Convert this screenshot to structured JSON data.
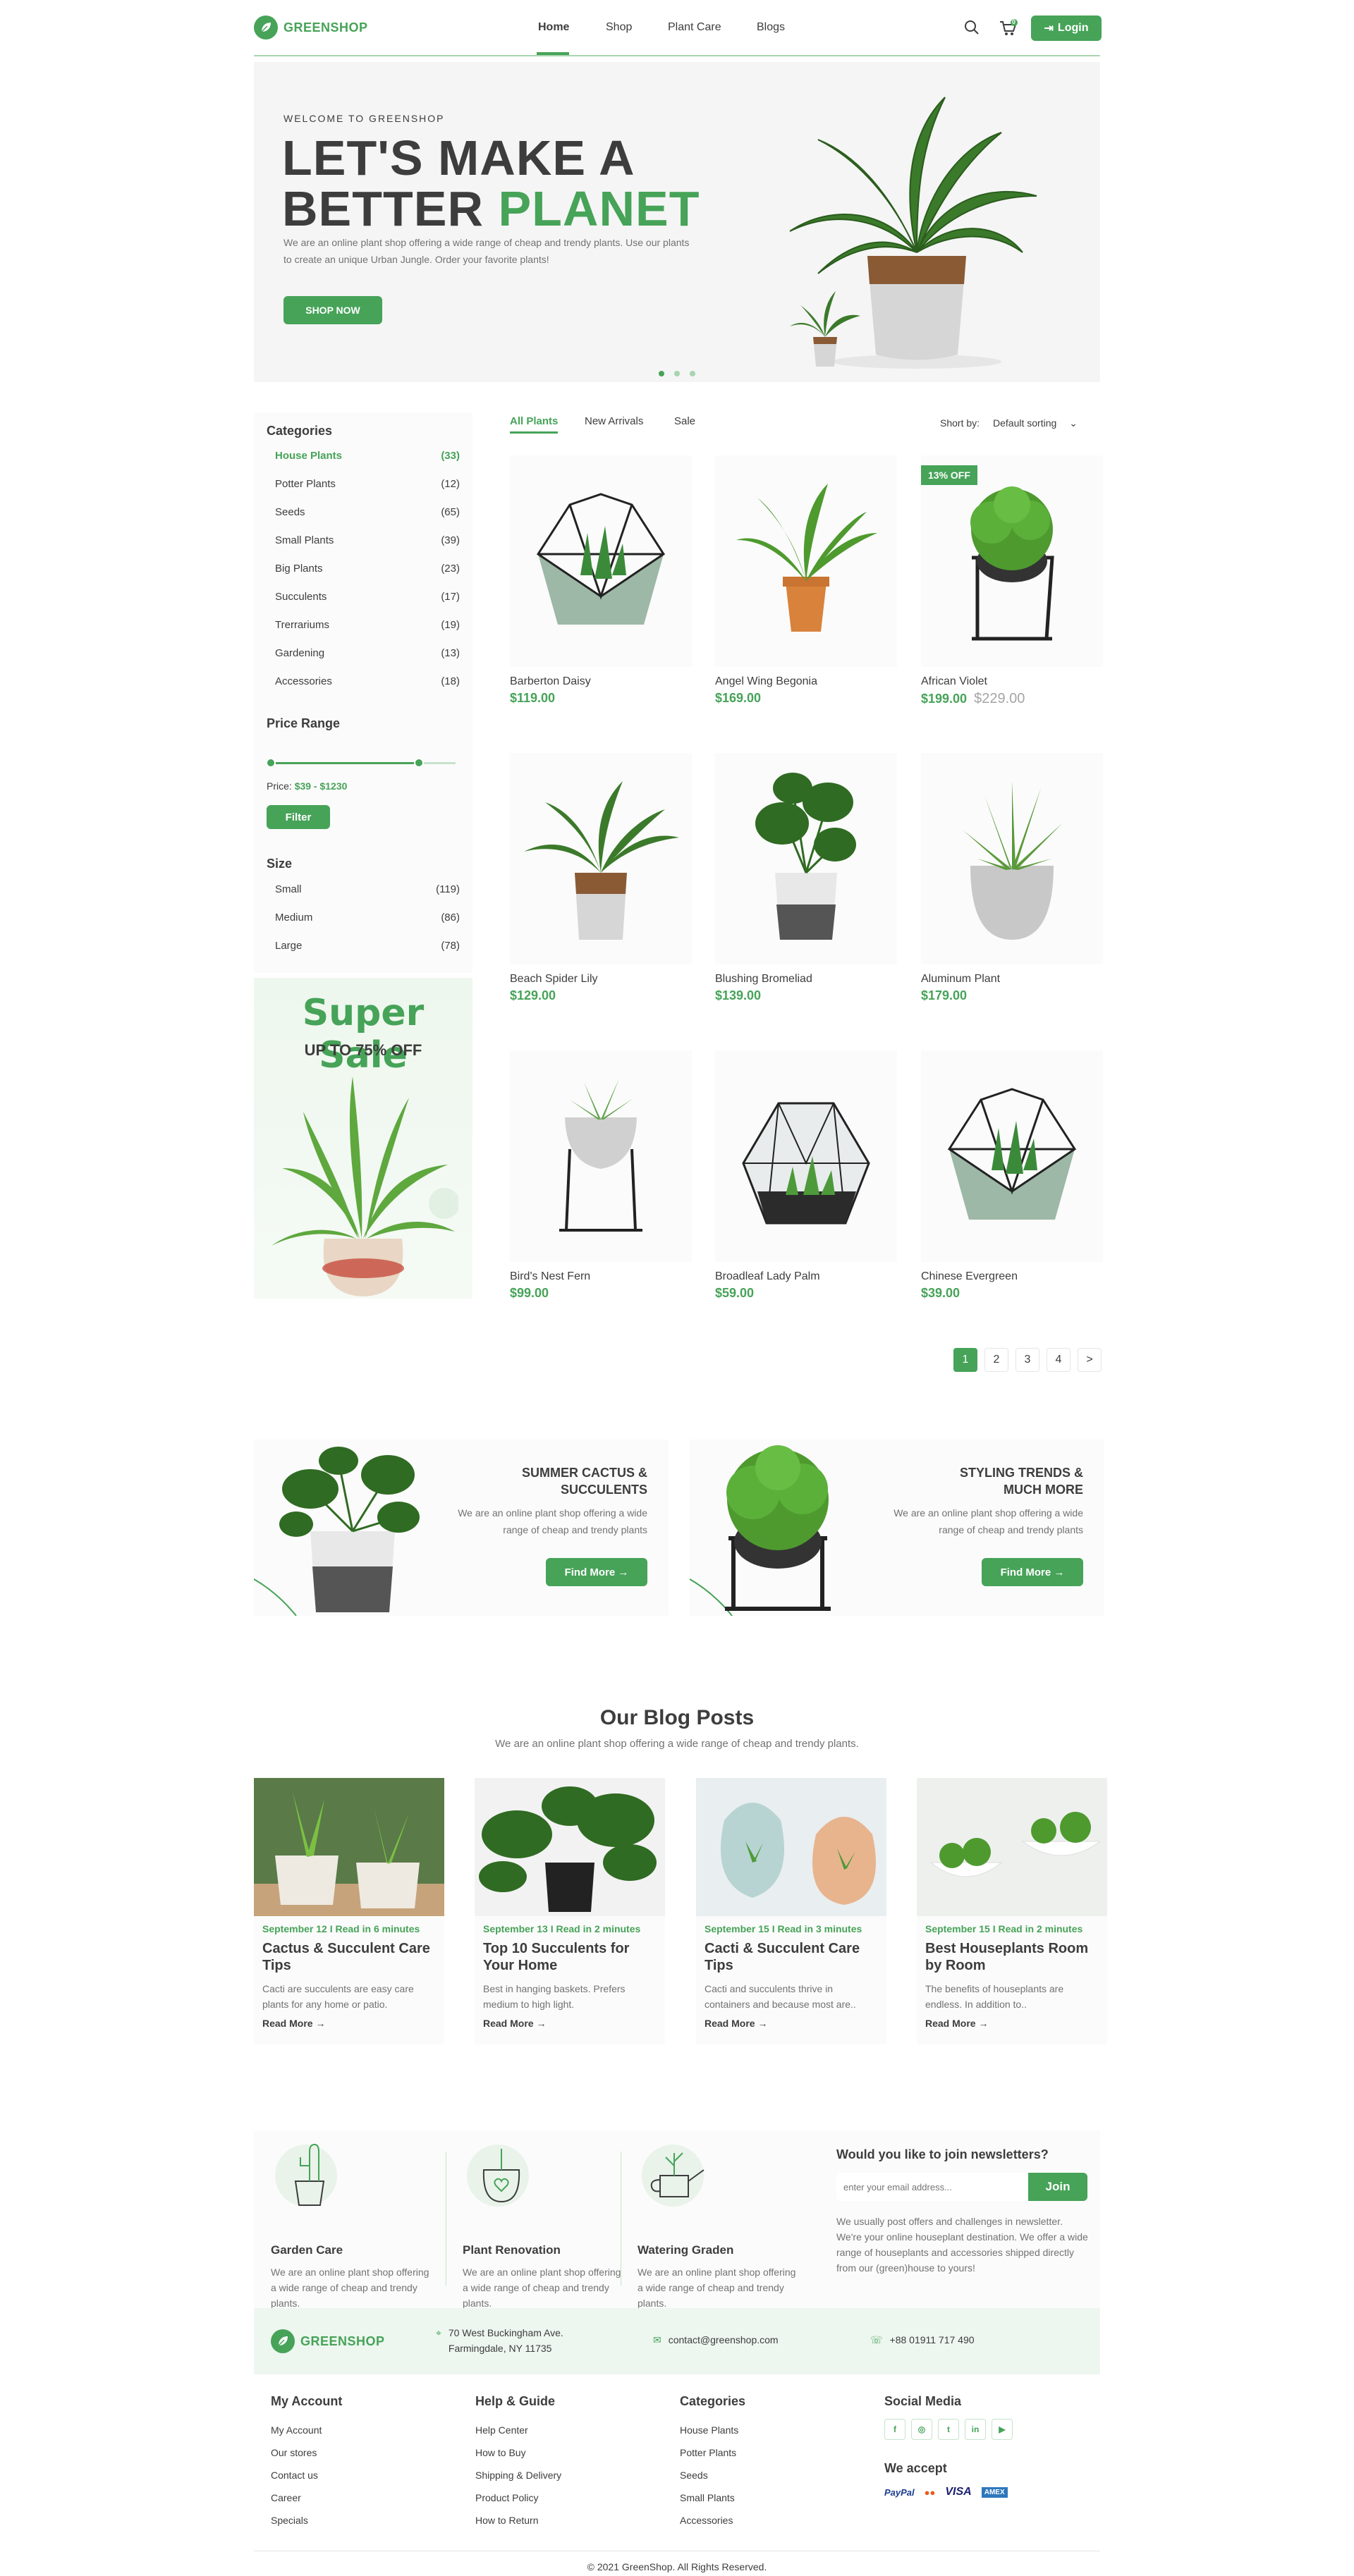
{
  "colors": {
    "accent": "#46a358",
    "text": "#3d3d3d",
    "muted": "#727272"
  },
  "header": {
    "brand": "GREENSHOP",
    "nav": [
      {
        "label": "Home",
        "active": true
      },
      {
        "label": "Shop"
      },
      {
        "label": "Plant Care"
      },
      {
        "label": "Blogs"
      }
    ],
    "cart_count": "0",
    "login_label": "Login",
    "icons": [
      "search-icon",
      "cart-icon",
      "login-icon"
    ]
  },
  "hero": {
    "welcome": "WELCOME TO GREENSHOP",
    "title_line1": "LET'S MAKE A",
    "title_line2_a": "BETTER ",
    "title_line2_b": "PLANET",
    "description": "We are an online plant shop offering a wide range of cheap and trendy plants. Use our plants to create an unique Urban Jungle. Order your favorite plants!",
    "cta": "SHOP NOW",
    "active_slide": 1,
    "slides": 3
  },
  "sidebar": {
    "categories_title": "Categories",
    "categories": [
      {
        "label": "House Plants",
        "count": "(33)",
        "active": true
      },
      {
        "label": "Potter Plants",
        "count": "(12)"
      },
      {
        "label": "Seeds",
        "count": "(65)"
      },
      {
        "label": "Small Plants",
        "count": "(39)"
      },
      {
        "label": "Big Plants",
        "count": "(23)"
      },
      {
        "label": "Succulents",
        "count": "(17)"
      },
      {
        "label": "Trerrariums",
        "count": "(19)"
      },
      {
        "label": "Gardening",
        "count": "(13)"
      },
      {
        "label": "Accessories",
        "count": "(18)"
      }
    ],
    "price_title": "Price Range",
    "price_label": "Price: ",
    "price_value": "$39 - $1230",
    "price_min_fraction": 0.0,
    "price_max_fraction": 0.8,
    "filter_label": "Filter",
    "size_title": "Size",
    "sizes": [
      {
        "label": "Small",
        "count": "(119)"
      },
      {
        "label": "Medium",
        "count": "(86)"
      },
      {
        "label": "Large",
        "count": "(78)"
      }
    ],
    "sale": {
      "title": "Super Sale",
      "subtitle": "UP TO 75% OFF"
    }
  },
  "products": {
    "tabs": [
      {
        "label": "All Plants",
        "active": true
      },
      {
        "label": "New Arrivals"
      },
      {
        "label": "Sale"
      }
    ],
    "sort_label": "Short by:",
    "sort_value": "Default sorting",
    "items": [
      {
        "name": "Barberton Daisy",
        "price": "$119.00"
      },
      {
        "name": "Angel Wing Begonia",
        "price": "$169.00"
      },
      {
        "name": "African Violet",
        "price": "$199.00",
        "old_price": "$229.00",
        "badge": "13% OFF"
      },
      {
        "name": "Beach Spider Lily",
        "price": "$129.00"
      },
      {
        "name": "Blushing Bromeliad",
        "price": "$139.00"
      },
      {
        "name": "Aluminum Plant",
        "price": "$179.00"
      },
      {
        "name": "Bird's Nest Fern",
        "price": "$99.00"
      },
      {
        "name": "Broadleaf Lady Palm",
        "price": "$59.00"
      },
      {
        "name": "Chinese Evergreen",
        "price": "$39.00"
      }
    ],
    "pagination": [
      "1",
      "2",
      "3",
      "4",
      ">"
    ],
    "current_page": "1"
  },
  "promos": [
    {
      "title": "SUMMER CACTUS & SUCCULENTS",
      "text": "We are an online plant shop offering a wide range of cheap and trendy plants",
      "cta": "Find More →"
    },
    {
      "title": "STYLING TRENDS & MUCH MORE",
      "text": "We are an online plant shop offering a wide range of cheap and trendy plants",
      "cta": "Find More →"
    }
  ],
  "blog": {
    "title": "Our Blog Posts",
    "subtitle": "We are an online plant shop offering a wide range of cheap and trendy plants.",
    "read_more": "Read More →",
    "posts": [
      {
        "meta": "September 12 I Read in 6 minutes",
        "title": "Cactus & Succulent Care Tips",
        "text": "Cacti are succulents are easy care plants for any home or patio."
      },
      {
        "meta": "September 13 I Read in 2 minutes",
        "title": "Top 10 Succulents for Your Home",
        "text": "Best in hanging baskets. Prefers medium to high light."
      },
      {
        "meta": "September 15 I Read in 3 minutes",
        "title": "Cacti & Succulent Care Tips",
        "text": "Cacti and succulents thrive in containers and because most are.."
      },
      {
        "meta": "September 15 I Read in 2 minutes",
        "title": "Best Houseplants Room by Room",
        "text": "The benefits of houseplants are endless. In addition to.."
      }
    ]
  },
  "services": [
    {
      "title": "Garden Care",
      "text": "We are an online plant shop offering a wide range of cheap and trendy plants."
    },
    {
      "title": "Plant Renovation",
      "text": "We are an online plant shop offering a wide range of cheap and trendy plants."
    },
    {
      "title": "Watering Graden",
      "text": "We are an online plant shop offering a wide range of cheap and trendy plants."
    }
  ],
  "newsletter": {
    "title": "Would you like to join newsletters?",
    "placeholder": "enter your email address...",
    "join": "Join",
    "text": "We usually post offers and challenges in newsletter. We're your online houseplant destination. We offer a wide range of houseplants and accessories shipped directly from our (green)house to yours!"
  },
  "contact": {
    "brand": "GREENSHOP",
    "address_line1": "70 West Buckingham Ave.",
    "address_line2": "Farmingdale, NY 11735",
    "email": "contact@greenshop.com",
    "phone": "+88 01911 717 490"
  },
  "footer": {
    "columns": [
      {
        "title": "My Account",
        "links": [
          "My Account",
          "Our stores",
          "Contact us",
          "Career",
          "Specials"
        ]
      },
      {
        "title": "Help & Guide",
        "links": [
          "Help Center",
          "How to Buy",
          "Shipping & Delivery",
          "Product Policy",
          "How to Return"
        ]
      },
      {
        "title": "Categories",
        "links": [
          "House Plants",
          "Potter Plants",
          "Seeds",
          "Small Plants",
          "Accessories"
        ]
      }
    ],
    "social_title": "Social Media",
    "social": [
      "f",
      "◎",
      "t",
      "in",
      "▶"
    ],
    "accept_title": "We accept",
    "payments": [
      "PayPal",
      "●●",
      "VISA",
      "AMEX"
    ],
    "copyright": "© 2021 GreenShop. All Rights Reserved."
  }
}
